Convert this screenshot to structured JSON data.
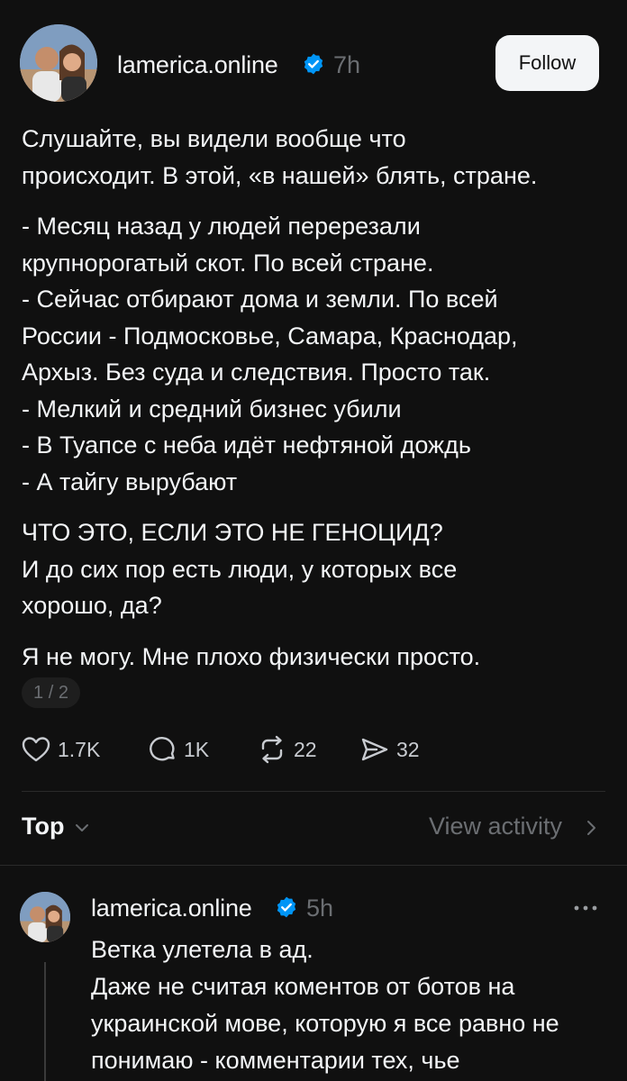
{
  "post": {
    "username": "lamerica.online",
    "timestamp": "7h",
    "follow_label": "Follow",
    "paragraphs": [
      [
        "Слушайте, вы видели вообще что",
        "происходит. В этой, «в нашей» блять, стране."
      ],
      [
        "- Месяц назад у людей перерезали",
        "крупнорогатый скот. По всей стране.",
        "- Сейчас отбирают дома и земли. По всей",
        "России - Подмосковье, Самара, Краснодар,",
        "Архыз. Без суда и следствия. Просто так.",
        "- Мелкий и средний бизнес убили",
        "- В Туапсе с неба идёт нефтяной дождь",
        "- А тайгу вырубают"
      ],
      [
        "ЧТО ЭТО, ЕСЛИ ЭТО НЕ ГЕНОЦИД?",
        "И до сих пор есть люди, у которых все",
        "хорошо, да?"
      ],
      [
        "Я не могу. Мне плохо физически просто."
      ]
    ],
    "page_indicator": "1 / 2",
    "actions": {
      "likes": "1.7K",
      "comments": "1K",
      "reposts": "22",
      "shares": "32"
    }
  },
  "sort_bar": {
    "sort_label": "Top",
    "view_activity_label": "View activity"
  },
  "reply": {
    "username": "lamerica.online",
    "timestamp": "5h",
    "more_label": "···",
    "lines": [
      "Ветка улетела в ад.",
      "Даже не считая коментов от ботов на",
      "украинской мове, которую я все равно не",
      "понимаю - комментарии тех, чье"
    ]
  },
  "icons": {
    "verified": "verified-badge-icon",
    "like": "heart-icon",
    "comment": "comment-bubble-icon",
    "repost": "repost-icon",
    "share": "send-icon",
    "sort": "chevron-down-icon",
    "activity": "chevron-right-icon",
    "more": "more-options-icon"
  },
  "colors": {
    "background": "#101010",
    "text": "#f3f5f7",
    "muted": "#6b6e72",
    "verified": "#0095f6"
  }
}
